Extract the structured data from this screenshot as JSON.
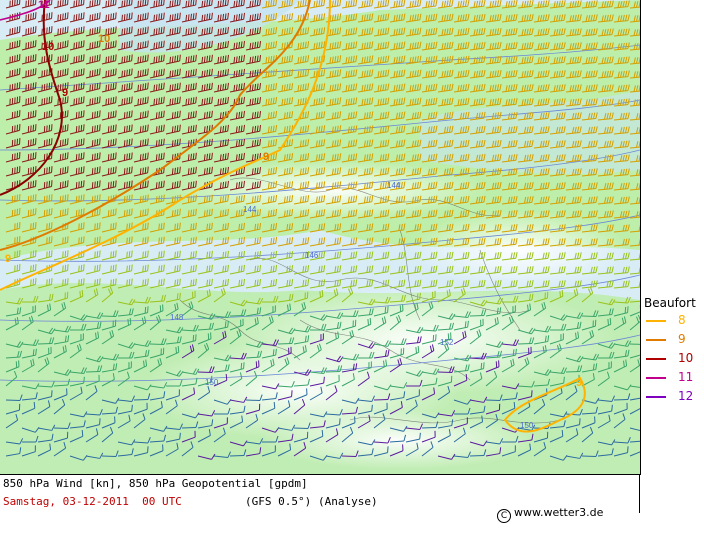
{
  "map": {
    "wind_barb_colors": {
      "storm": "#8b1a1a",
      "strong": "#d4a000",
      "moderate": "#9ac21a",
      "light": "#3aa56a",
      "calm": "#2b6aa0",
      "convergence": "#5b1a9e"
    },
    "background_colors": {
      "sea": "#d8ecf6",
      "low_speed": "#b8ee9c",
      "terrain": "#e9e9e9"
    },
    "geopotential_labels": [
      "144",
      "144",
      "146",
      "148",
      "150",
      "152",
      "150"
    ],
    "beaufort_contour_labels": [
      "11",
      "10",
      "9",
      "10",
      "9",
      "9",
      "9"
    ]
  },
  "legend": {
    "title": "Beaufort",
    "items": [
      {
        "label": "8",
        "color": "#ffb300"
      },
      {
        "label": "9",
        "color": "#e07b00"
      },
      {
        "label": "10",
        "color": "#b00000"
      },
      {
        "label": "11",
        "color": "#c0008c"
      },
      {
        "label": "12",
        "color": "#8000c0"
      }
    ]
  },
  "footer": {
    "line1": "850 hPa Wind [kn], 850 hPa Geopotential [gpdm]",
    "date": "Samstag, 03-12-2011  00 UTC",
    "model": "(GFS 0.5°)",
    "analyse": "(Analyse)",
    "copyright": "www.wetter3.de"
  }
}
